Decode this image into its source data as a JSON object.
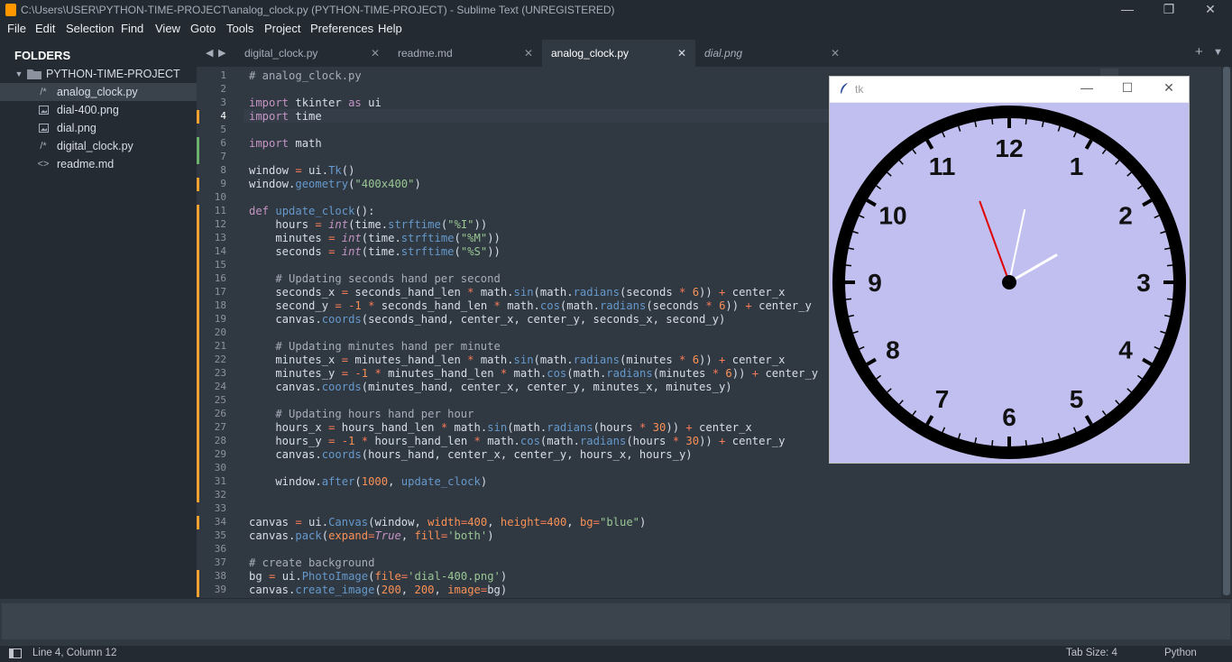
{
  "window": {
    "title": "C:\\Users\\USER\\PYTHON-TIME-PROJECT\\analog_clock.py (PYTHON-TIME-PROJECT) - Sublime Text (UNREGISTERED)",
    "minimize": "—",
    "restore": "❐",
    "close": "✕"
  },
  "menu": [
    "File",
    "Edit",
    "Selection",
    "Find",
    "View",
    "Goto",
    "Tools",
    "Project",
    "Preferences",
    "Help"
  ],
  "sidebar": {
    "header": "FOLDERS",
    "project": "PYTHON-TIME-PROJECT",
    "items": [
      {
        "label": "analog_clock.py",
        "icon": "code-file-icon"
      },
      {
        "label": "dial-400.png",
        "icon": "image-file-icon"
      },
      {
        "label": "dial.png",
        "icon": "image-file-icon"
      },
      {
        "label": "digital_clock.py",
        "icon": "code-file-icon"
      },
      {
        "label": "readme.md",
        "icon": "markup-file-icon"
      }
    ]
  },
  "tabs": [
    {
      "label": "digital_clock.py",
      "active": false
    },
    {
      "label": "readme.md",
      "active": false
    },
    {
      "label": "analog_clock.py",
      "active": true
    },
    {
      "label": "dial.png",
      "active": false
    }
  ],
  "editor": {
    "current_line": 4,
    "line_numbers": [
      "1",
      "2",
      "3",
      "4",
      "5",
      "6",
      "7",
      "8",
      "9",
      "10",
      "11",
      "12",
      "13",
      "14",
      "15",
      "16",
      "17",
      "18",
      "19",
      "20",
      "21",
      "22",
      "23",
      "24",
      "25",
      "26",
      "27",
      "28",
      "29",
      "30",
      "31",
      "32",
      "33",
      "34",
      "35",
      "36",
      "37",
      "38",
      "39"
    ],
    "lines": [
      "# analog_clock.py",
      "",
      "import tkinter as ui",
      "import time",
      "",
      "import math",
      "",
      "window = ui.Tk()",
      "window.geometry(\"400x400\")",
      "",
      "def update_clock():",
      "    hours = int(time.strftime(\"%I\"))",
      "    minutes = int(time.strftime(\"%M\"))",
      "    seconds = int(time.strftime(\"%S\"))",
      "",
      "    # Updating seconds hand per second",
      "    seconds_x = seconds_hand_len * math.sin(math.radians(seconds * 6)) + center_x",
      "    second_y = -1 * seconds_hand_len * math.cos(math.radians(seconds * 6)) + center_y",
      "    canvas.coords(seconds_hand, center_x, center_y, seconds_x, second_y)",
      "",
      "    # Updating minutes hand per minute",
      "    minutes_x = minutes_hand_len * math.sin(math.radians(minutes * 6)) + center_x",
      "    minutes_y = -1 * minutes_hand_len * math.cos(math.radians(minutes * 6)) + center_y",
      "    canvas.coords(minutes_hand, center_x, center_y, minutes_x, minutes_y)",
      "",
      "    # Updating hours hand per hour",
      "    hours_x = hours_hand_len * math.sin(math.radians(hours * 30)) + center_x",
      "    hours_y = -1 * hours_hand_len * math.cos(math.radians(hours * 30)) + center_y",
      "    canvas.coords(hours_hand, center_x, center_y, hours_x, hours_y)",
      "",
      "    window.after(1000, update_clock)",
      "",
      "",
      "canvas = ui.Canvas(window, width=400, height=400, bg=\"blue\")",
      "canvas.pack(expand=True, fill='both')",
      "",
      "# create background",
      "bg = ui.PhotoImage(file='dial-400.png')",
      "canvas.create_image(200, 200, image=bg)"
    ]
  },
  "status": {
    "position": "Line 4, Column 12",
    "tab_size": "Tab Size: 4",
    "syntax": "Python"
  },
  "tk_window": {
    "title": "tk",
    "minimize": "—",
    "maximize": "☐",
    "close": "✕",
    "clock": {
      "numerals": [
        "12",
        "1",
        "2",
        "3",
        "4",
        "5",
        "6",
        "7",
        "8",
        "9",
        "10",
        "11"
      ],
      "hand_angles_deg": {
        "seconds": -20,
        "minutes": 12,
        "hours": 60
      }
    }
  },
  "colors": {
    "editor_bg": "#303841",
    "sidebar_bg": "#252b33",
    "clock_face": "#c0bff0",
    "seconds_hand": "#e00000",
    "modified_marker": "#f0a030",
    "added_marker": "#6cb26c"
  }
}
